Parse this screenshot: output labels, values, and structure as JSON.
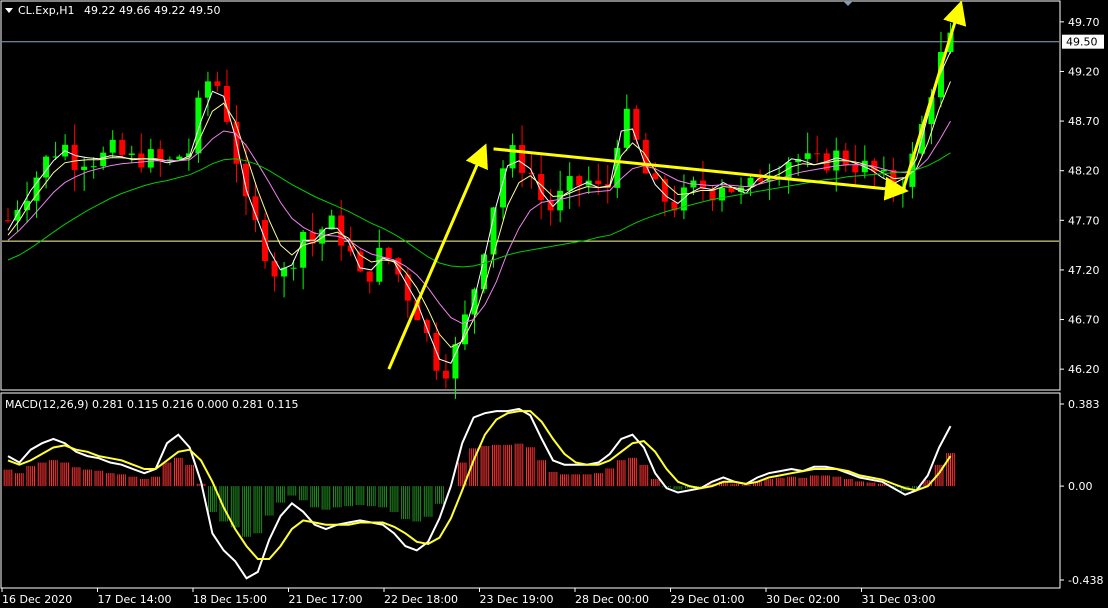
{
  "header": {
    "symbol_label": "CL.Exp,H1",
    "ohlc_label": "49.22 49.66 49.22 49.50"
  },
  "macd_header": {
    "label": "MACD(12,26,9) 0.281 0.115 0.216 0.000 0.281 0.115"
  },
  "price_marker": {
    "label": "49.50",
    "value": 49.5
  },
  "colors": {
    "background": "#000000",
    "frame": "#ffffff",
    "bull_candle": "#00ff00",
    "bear_candle": "#ff0000",
    "ma_fast": "#ffffff",
    "ma_mid": "#ffff99",
    "ma_slow": "#ee82ee",
    "ma_long": "#00cc00",
    "annotation": "#ffff00",
    "macd_line": "#ffffff",
    "signal_line": "#ffff33",
    "hist_pos": "#ff3333",
    "hist_neg": "#228b22",
    "hline": "#ffff99",
    "price_line": "#87a8c8"
  },
  "chart_data": [
    {
      "type": "candlestick",
      "symbol": "CL.Exp",
      "timeframe": "H1",
      "ylim": [
        46.0,
        49.9
      ],
      "y_ticks": [
        49.7,
        49.2,
        48.7,
        48.2,
        47.7,
        47.2,
        46.7,
        46.2
      ],
      "y_tick_labels": [
        "49.70",
        "49.20",
        "48.70",
        "48.20",
        "47.70",
        "47.20",
        "46.70",
        "46.20"
      ],
      "x_tick_labels": [
        "16 Dec 2020",
        "17 Dec 14:00",
        "18 Dec 15:00",
        "21 Dec 17:00",
        "22 Dec 18:00",
        "23 Dec 19:00",
        "28 Dec 00:00",
        "29 Dec 01:00",
        "30 Dec 02:00",
        "31 Dec 03:00"
      ],
      "horizontal_line": 47.49,
      "current_price": 49.5,
      "price_path": [
        47.7,
        47.9,
        48.05,
        48.25,
        48.4,
        48.45,
        48.3,
        48.35,
        48.3,
        48.4,
        48.35,
        48.3,
        48.35,
        48.3,
        48.25,
        48.35,
        48.4,
        48.95,
        49.2,
        48.9,
        48.4,
        47.8,
        47.6,
        47.3,
        47.1,
        47.3,
        47.6,
        47.45,
        47.7,
        47.6,
        47.4,
        47.1,
        47.2,
        47.4,
        47.25,
        47.0,
        46.8,
        46.5,
        46.2,
        46.25,
        46.6,
        47.0,
        47.5,
        48.0,
        48.4,
        48.3,
        48.2,
        47.9,
        47.8,
        48.0,
        48.05,
        48.1,
        48.0,
        48.05,
        48.8,
        48.6,
        48.2,
        48.0,
        47.9,
        47.85,
        48.0,
        48.05,
        48.0,
        48.1,
        48.0,
        47.95,
        48.15,
        48.2,
        48.25,
        48.35,
        48.3,
        48.25,
        48.3,
        48.35,
        48.3,
        48.25,
        48.2,
        48.1,
        48.05,
        48.15,
        48.4,
        48.9,
        49.3,
        49.5
      ],
      "series": [
        {
          "name": "MA fast",
          "values": [
            47.6,
            47.8,
            48.0,
            48.15,
            48.3,
            48.4,
            48.35,
            48.33,
            48.32,
            48.35,
            48.34,
            48.31,
            48.32,
            48.31,
            48.28,
            48.3,
            48.35,
            48.7,
            49.0,
            48.95,
            48.55,
            48.0,
            47.7,
            47.4,
            47.2,
            47.25,
            47.5,
            47.5,
            47.62,
            47.62,
            47.48,
            47.22,
            47.2,
            47.32,
            47.28,
            47.08,
            46.88,
            46.58,
            46.3,
            46.26,
            46.5,
            46.88,
            47.35,
            47.85,
            48.25,
            48.3,
            48.22,
            47.98,
            47.84,
            47.96,
            48.03,
            48.08,
            48.03,
            48.05,
            48.6,
            48.62,
            48.3,
            48.06,
            47.94,
            47.87,
            47.97,
            48.03,
            48.01,
            48.08,
            48.02,
            47.97,
            48.11,
            48.18,
            48.23,
            48.32,
            48.3,
            48.26,
            48.29,
            48.33,
            48.3,
            48.26,
            48.21,
            48.13,
            48.07,
            48.13,
            48.32,
            48.75,
            49.15,
            49.4
          ]
        },
        {
          "name": "MA mid",
          "values": [
            47.55,
            47.7,
            47.88,
            48.03,
            48.18,
            48.28,
            48.3,
            48.31,
            48.31,
            48.33,
            48.33,
            48.32,
            48.32,
            48.32,
            48.3,
            48.3,
            48.33,
            48.55,
            48.8,
            48.88,
            48.7,
            48.35,
            48.0,
            47.7,
            47.45,
            47.35,
            47.45,
            47.48,
            47.55,
            47.58,
            47.52,
            47.35,
            47.28,
            47.3,
            47.29,
            47.18,
            47.02,
            46.8,
            46.55,
            46.42,
            46.48,
            46.7,
            47.05,
            47.45,
            47.85,
            48.08,
            48.15,
            48.05,
            47.94,
            47.95,
            48.0,
            48.04,
            48.03,
            48.04,
            48.35,
            48.48,
            48.38,
            48.2,
            48.06,
            47.96,
            47.97,
            48.0,
            48.0,
            48.04,
            48.03,
            48.0,
            48.06,
            48.12,
            48.17,
            48.24,
            48.27,
            48.26,
            48.28,
            48.3,
            48.3,
            48.28,
            48.24,
            48.18,
            48.12,
            48.13,
            48.22,
            48.48,
            48.82,
            49.1
          ]
        },
        {
          "name": "MA slow",
          "values": [
            47.5,
            47.6,
            47.72,
            47.85,
            47.98,
            48.08,
            48.14,
            48.19,
            48.22,
            48.25,
            48.27,
            48.28,
            48.29,
            48.3,
            48.3,
            48.3,
            48.31,
            48.4,
            48.52,
            48.6,
            48.58,
            48.45,
            48.27,
            48.08,
            47.88,
            47.72,
            47.63,
            47.57,
            47.55,
            47.54,
            47.5,
            47.42,
            47.36,
            47.33,
            47.3,
            47.24,
            47.15,
            47.02,
            46.86,
            46.72,
            46.66,
            46.7,
            46.85,
            47.08,
            47.38,
            47.62,
            47.8,
            47.88,
            47.9,
            47.92,
            47.95,
            47.98,
            47.99,
            48.0,
            48.12,
            48.22,
            48.25,
            48.22,
            48.16,
            48.1,
            48.07,
            48.06,
            48.05,
            48.06,
            48.05,
            48.04,
            48.06,
            48.09,
            48.12,
            48.16,
            48.19,
            48.21,
            48.23,
            48.25,
            48.26,
            48.26,
            48.25,
            48.22,
            48.19,
            48.18,
            48.21,
            48.32,
            48.5,
            48.7
          ]
        },
        {
          "name": "MA long",
          "values": [
            47.3,
            47.35,
            47.42,
            47.5,
            47.58,
            47.66,
            47.73,
            47.8,
            47.86,
            47.92,
            47.97,
            48.01,
            48.05,
            48.08,
            48.1,
            48.13,
            48.16,
            48.21,
            48.27,
            48.31,
            48.32,
            48.3,
            48.26,
            48.2,
            48.13,
            48.06,
            48.0,
            47.94,
            47.89,
            47.84,
            47.79,
            47.73,
            47.67,
            47.62,
            47.56,
            47.49,
            47.41,
            47.33,
            47.27,
            47.24,
            47.23,
            47.24,
            47.27,
            47.31,
            47.35,
            47.38,
            47.4,
            47.42,
            47.44,
            47.46,
            47.48,
            47.5,
            47.53,
            47.55,
            47.6,
            47.66,
            47.71,
            47.75,
            47.79,
            47.82,
            47.85,
            47.88,
            47.91,
            47.93,
            47.95,
            47.97,
            47.99,
            48.01,
            48.03,
            48.05,
            48.07,
            48.09,
            48.11,
            48.12,
            48.14,
            48.15,
            48.16,
            48.17,
            48.18,
            48.19,
            48.21,
            48.25,
            48.31,
            48.38
          ]
        }
      ],
      "annotations": [
        {
          "type": "arrow",
          "from": [
            40,
            46.2
          ],
          "to": [
            50,
            48.42
          ]
        },
        {
          "type": "arrow",
          "from": [
            51,
            48.42
          ],
          "to": [
            94,
            48.0
          ]
        },
        {
          "type": "arrow",
          "from": [
            94,
            48.0
          ],
          "to": [
            100,
            49.86
          ]
        }
      ]
    },
    {
      "type": "macd",
      "params": "MACD(12,26,9)",
      "ylim": [
        -0.438,
        0.383
      ],
      "y_ticks": [
        0.383,
        0.0,
        -0.438
      ],
      "y_tick_labels": [
        "0.383",
        "0.00",
        "-0.438"
      ],
      "macd_values": [
        0.14,
        0.11,
        0.17,
        0.2,
        0.22,
        0.2,
        0.16,
        0.14,
        0.13,
        0.11,
        0.1,
        0.08,
        0.06,
        0.08,
        0.2,
        0.24,
        0.18,
        0.02,
        -0.22,
        -0.3,
        -0.35,
        -0.43,
        -0.4,
        -0.25,
        -0.14,
        -0.08,
        -0.12,
        -0.18,
        -0.2,
        -0.18,
        -0.17,
        -0.16,
        -0.17,
        -0.18,
        -0.22,
        -0.28,
        -0.3,
        -0.26,
        -0.15,
        0.0,
        0.2,
        0.32,
        0.34,
        0.35,
        0.35,
        0.36,
        0.33,
        0.22,
        0.12,
        0.1,
        0.1,
        0.1,
        0.11,
        0.15,
        0.22,
        0.24,
        0.18,
        0.06,
        -0.01,
        -0.03,
        -0.02,
        -0.01,
        0.02,
        0.04,
        0.02,
        0.01,
        0.04,
        0.06,
        0.07,
        0.08,
        0.07,
        0.09,
        0.09,
        0.08,
        0.06,
        0.04,
        0.03,
        0.02,
        -0.01,
        -0.04,
        -0.02,
        0.05,
        0.18,
        0.28
      ],
      "signal_values": [
        0.12,
        0.1,
        0.12,
        0.15,
        0.18,
        0.19,
        0.17,
        0.16,
        0.14,
        0.13,
        0.12,
        0.1,
        0.08,
        0.08,
        0.12,
        0.16,
        0.17,
        0.12,
        0.02,
        -0.1,
        -0.2,
        -0.28,
        -0.34,
        -0.34,
        -0.28,
        -0.2,
        -0.16,
        -0.17,
        -0.18,
        -0.18,
        -0.18,
        -0.17,
        -0.17,
        -0.17,
        -0.19,
        -0.22,
        -0.26,
        -0.27,
        -0.24,
        -0.15,
        -0.02,
        0.12,
        0.24,
        0.31,
        0.34,
        0.35,
        0.35,
        0.3,
        0.22,
        0.15,
        0.11,
        0.1,
        0.1,
        0.12,
        0.16,
        0.2,
        0.21,
        0.16,
        0.08,
        0.02,
        0.0,
        -0.01,
        0.0,
        0.02,
        0.02,
        0.01,
        0.02,
        0.04,
        0.05,
        0.06,
        0.07,
        0.08,
        0.08,
        0.08,
        0.07,
        0.05,
        0.04,
        0.03,
        0.01,
        -0.01,
        -0.02,
        0.0,
        0.06,
        0.14
      ]
    }
  ]
}
